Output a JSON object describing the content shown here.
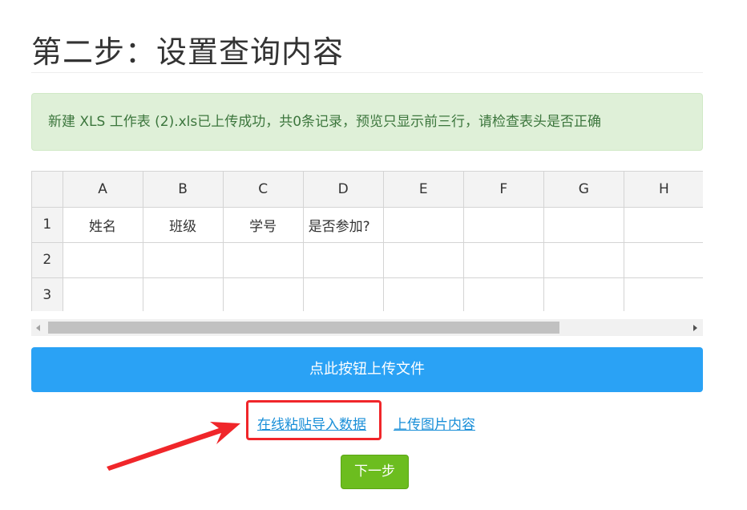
{
  "page": {
    "title": "第二步：设置查询内容"
  },
  "alert": {
    "message": "新建 XLS 工作表 (2).xls已上传成功，共0条记录，预览只显示前三行，请检查表头是否正确"
  },
  "sheet": {
    "columns": [
      "A",
      "B",
      "C",
      "D",
      "E",
      "F",
      "G",
      "H"
    ],
    "rows": [
      {
        "num": "1",
        "cells": [
          "姓名",
          "班级",
          "学号",
          "是否参加?",
          "",
          "",
          "",
          ""
        ]
      },
      {
        "num": "2",
        "cells": [
          "",
          "",
          "",
          "",
          "",
          "",
          "",
          ""
        ]
      },
      {
        "num": "3",
        "cells": [
          "",
          "",
          "",
          "",
          "",
          "",
          "",
          ""
        ]
      }
    ]
  },
  "actions": {
    "upload_label": "点此按钮上传文件",
    "paste_link_label": "在线粘贴导入数据",
    "image_link_label": "上传图片内容",
    "next_label": "下一步"
  },
  "colors": {
    "upload_button": "#2aa2f5",
    "next_button": "#6cbd1f",
    "highlight": "#f0262a",
    "alert_bg": "#dff0d8",
    "alert_text": "#3c763d"
  }
}
